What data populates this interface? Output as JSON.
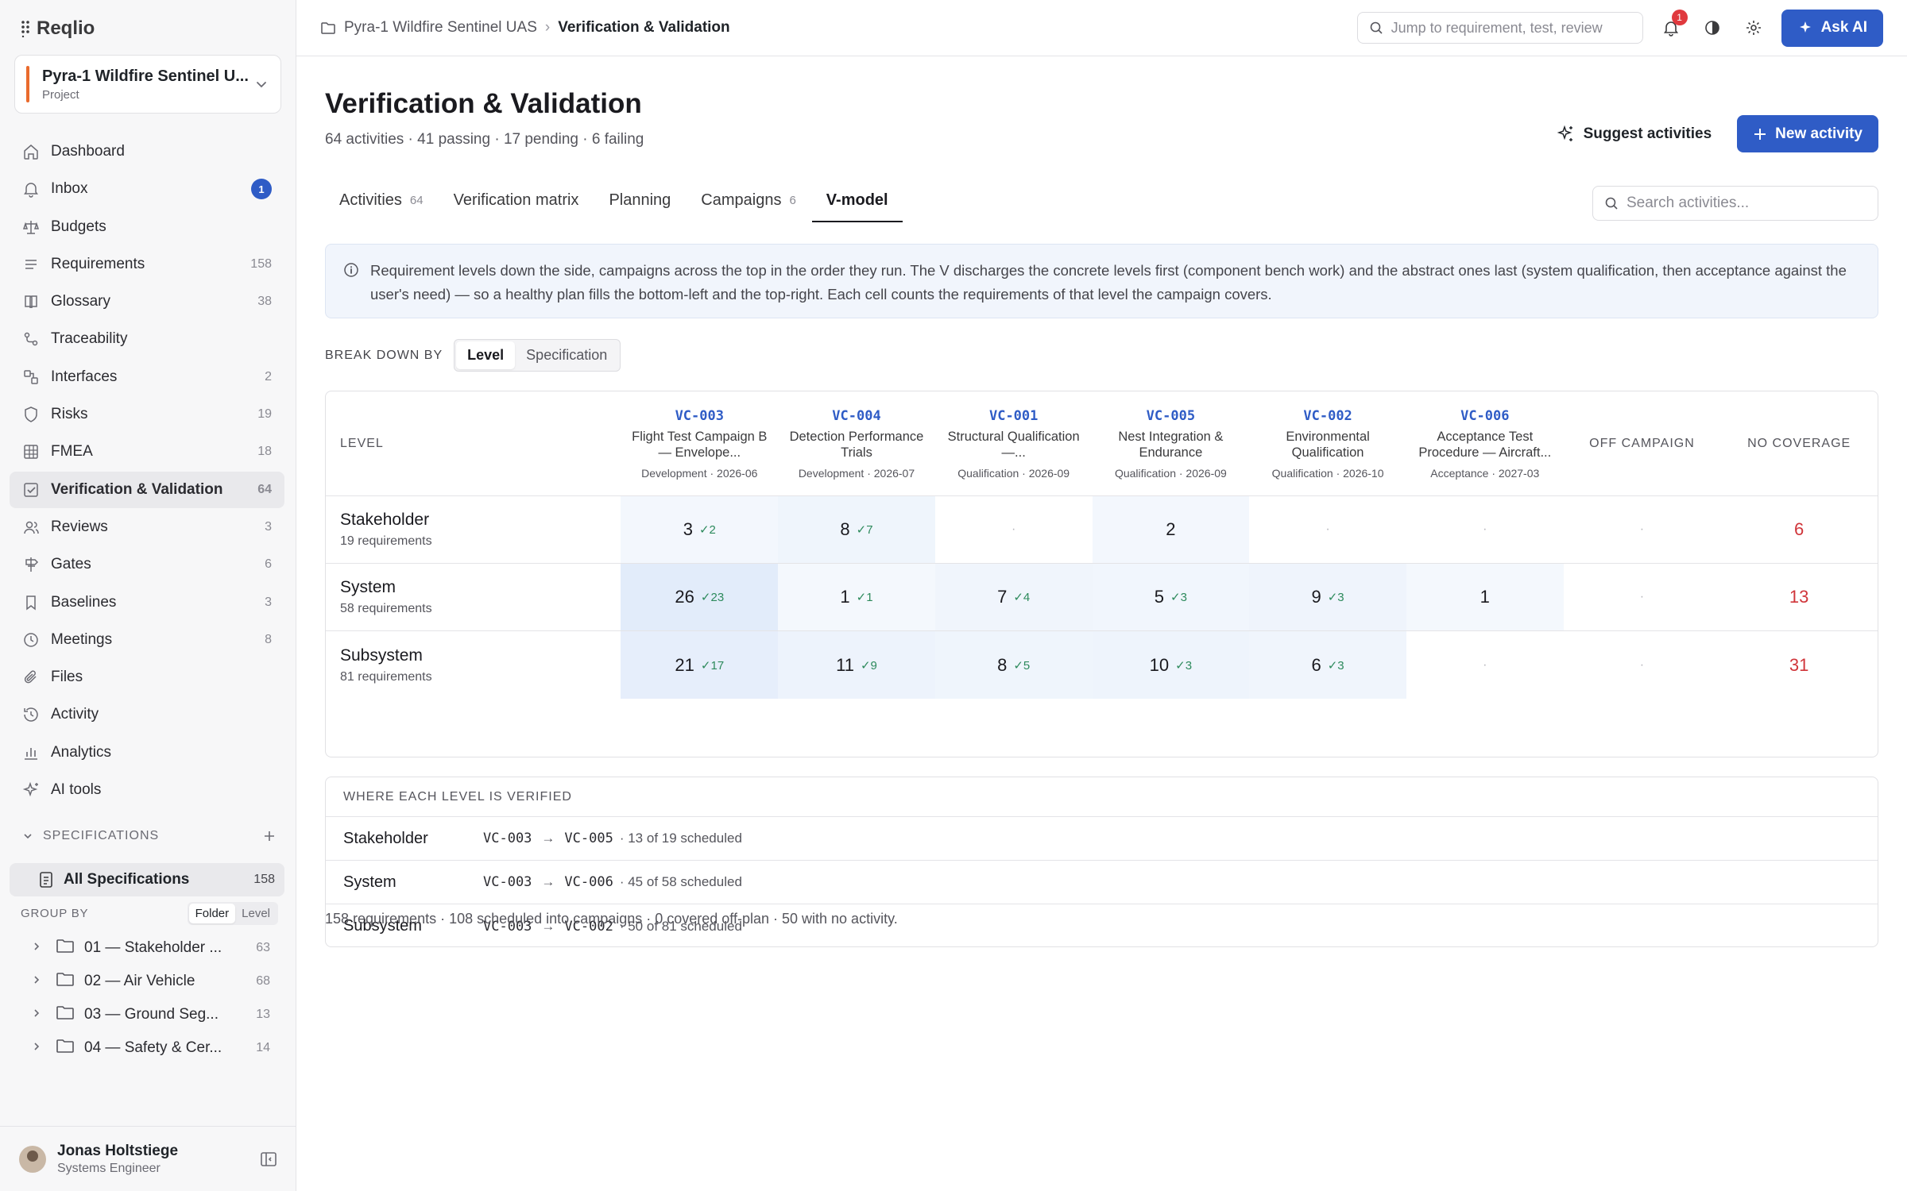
{
  "app": {
    "name": "Reqlio"
  },
  "project": {
    "name": "Pyra-1 Wildfire Sentinel U...",
    "type": "Project"
  },
  "nav": [
    {
      "label": "Dashboard",
      "icon": "home-icon",
      "count": ""
    },
    {
      "label": "Inbox",
      "icon": "bell-icon",
      "badge": "1"
    },
    {
      "label": "Budgets",
      "icon": "scale-icon",
      "count": ""
    },
    {
      "label": "Requirements",
      "icon": "list-icon",
      "count": "158"
    },
    {
      "label": "Glossary",
      "icon": "book-icon",
      "count": "38"
    },
    {
      "label": "Traceability",
      "icon": "traceability-icon",
      "count": ""
    },
    {
      "label": "Interfaces",
      "icon": "interfaces-icon",
      "count": "2"
    },
    {
      "label": "Risks",
      "icon": "shield-icon",
      "count": "19"
    },
    {
      "label": "FMEA",
      "icon": "grid-icon",
      "count": "18"
    },
    {
      "label": "Verification & Validation",
      "icon": "check-square-icon",
      "count": "64",
      "active": true
    },
    {
      "label": "Reviews",
      "icon": "reviews-icon",
      "count": "3"
    },
    {
      "label": "Gates",
      "icon": "signpost-icon",
      "count": "6"
    },
    {
      "label": "Baselines",
      "icon": "bookmark-icon",
      "count": "3"
    },
    {
      "label": "Meetings",
      "icon": "clock-icon",
      "count": "8"
    },
    {
      "label": "Files",
      "icon": "paperclip-icon",
      "count": ""
    },
    {
      "label": "Activity",
      "icon": "history-icon",
      "count": ""
    },
    {
      "label": "Analytics",
      "icon": "bar-chart-icon",
      "count": ""
    },
    {
      "label": "AI tools",
      "icon": "sparkle-icon",
      "count": ""
    }
  ],
  "specifications": {
    "heading": "SPECIFICATIONS",
    "all_label": "All Specifications",
    "all_count": "158",
    "group_by_label": "GROUP BY",
    "group_options": [
      "Folder",
      "Level"
    ],
    "folders": [
      {
        "label": "01 — Stakeholder ...",
        "count": "63"
      },
      {
        "label": "02 — Air Vehicle",
        "count": "68"
      },
      {
        "label": "03 — Ground Seg...",
        "count": "13"
      },
      {
        "label": "04 — Safety & Cer...",
        "count": "14"
      }
    ]
  },
  "user": {
    "name": "Jonas Holtstiege",
    "role": "Systems Engineer"
  },
  "topbar": {
    "breadcrumb_root": "Pyra-1 Wildfire Sentinel UAS",
    "breadcrumb_current": "Verification & Validation",
    "search_placeholder": "Jump to requirement, test, review",
    "notif_count": "1",
    "ask_ai": "Ask AI"
  },
  "page": {
    "title": "Verification & Validation",
    "subtitle": "64 activities · 41 passing · 17 pending · 6 failing",
    "suggest_label": "Suggest activities",
    "new_label": "New activity",
    "search_placeholder": "Search activities..."
  },
  "tabs": [
    {
      "label": "Activities",
      "count": "64"
    },
    {
      "label": "Verification matrix",
      "count": ""
    },
    {
      "label": "Planning",
      "count": ""
    },
    {
      "label": "Campaigns",
      "count": "6"
    },
    {
      "label": "V-model",
      "count": "",
      "active": true
    }
  ],
  "info_text": "Requirement levels down the side, campaigns across the top in the order they run. The V discharges the concrete levels first (component bench work) and the abstract ones last (system qualification, then acceptance against the user's need) — so a healthy plan fills the bottom-left and the top-right. Each cell counts the requirements of that level the campaign covers.",
  "breakdown": {
    "label": "BREAK DOWN BY",
    "options": [
      "Level",
      "Specification"
    ],
    "selected": "Level"
  },
  "matrix": {
    "level_header": "LEVEL",
    "campaigns": [
      {
        "id": "VC-003",
        "name": "Flight Test Campaign B — Envelope...",
        "meta": "Development · 2026-06"
      },
      {
        "id": "VC-004",
        "name": "Detection Performance Trials",
        "meta": "Development · 2026-07"
      },
      {
        "id": "VC-001",
        "name": "Structural Qualification —...",
        "meta": "Qualification · 2026-09"
      },
      {
        "id": "VC-005",
        "name": "Nest Integration & Endurance",
        "meta": "Qualification · 2026-09"
      },
      {
        "id": "VC-002",
        "name": "Environmental Qualification",
        "meta": "Qualification · 2026-10"
      },
      {
        "id": "VC-006",
        "name": "Acceptance Test Procedure — Aircraft...",
        "meta": "Acceptance · 2027-03"
      }
    ],
    "off_campaign_header": "OFF CAMPAIGN",
    "no_coverage_header": "NO COVERAGE",
    "rows": [
      {
        "level": "Stakeholder",
        "sub": "19 requirements",
        "cells": [
          {
            "v": "3",
            "c": "✓2"
          },
          {
            "v": "8",
            "c": "✓7"
          },
          {
            "v": "·",
            "c": ""
          },
          {
            "v": "2",
            "c": ""
          },
          {
            "v": "·",
            "c": ""
          },
          {
            "v": "·",
            "c": ""
          }
        ],
        "off": "·",
        "none": "6"
      },
      {
        "level": "System",
        "sub": "58 requirements",
        "cells": [
          {
            "v": "26",
            "c": "✓23"
          },
          {
            "v": "1",
            "c": "✓1"
          },
          {
            "v": "7",
            "c": "✓4"
          },
          {
            "v": "5",
            "c": "✓3"
          },
          {
            "v": "9",
            "c": "✓3"
          },
          {
            "v": "1",
            "c": ""
          }
        ],
        "off": "·",
        "none": "13"
      },
      {
        "level": "Subsystem",
        "sub": "81 requirements",
        "cells": [
          {
            "v": "21",
            "c": "✓17"
          },
          {
            "v": "11",
            "c": "✓9"
          },
          {
            "v": "8",
            "c": "✓5"
          },
          {
            "v": "10",
            "c": "✓3"
          },
          {
            "v": "6",
            "c": "✓3"
          },
          {
            "v": "·",
            "c": ""
          }
        ],
        "off": "·",
        "none": "31"
      }
    ]
  },
  "where": {
    "heading": "WHERE EACH LEVEL IS VERIFIED",
    "rows": [
      {
        "level": "Stakeholder",
        "from": "VC-003",
        "to": "VC-005",
        "summary": "· 13 of 19 scheduled"
      },
      {
        "level": "System",
        "from": "VC-003",
        "to": "VC-006",
        "summary": "· 45 of 58 scheduled"
      },
      {
        "level": "Subsystem",
        "from": "VC-003",
        "to": "VC-002",
        "summary": "· 50 of 81 scheduled"
      }
    ]
  },
  "footer_summary": "158 requirements · 108 scheduled into campaigns · 0 covered off-plan · 50 with no activity.",
  "colors": {
    "accent": "#2f5cc6",
    "pass": "#2d8a5c",
    "fail": "#d0353a",
    "project_bar": "#ea6b2d"
  }
}
